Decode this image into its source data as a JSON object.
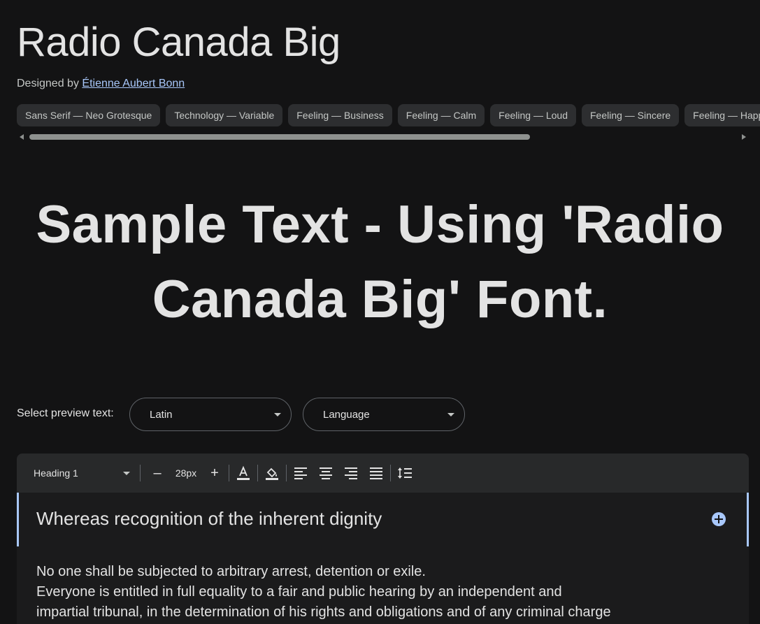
{
  "font": {
    "title": "Radio Canada Big",
    "designed_by_prefix": "Designed by",
    "designer_name": "Étienne Aubert Bonn"
  },
  "tags": [
    "Sans Serif — Neo Grotesque",
    "Technology — Variable",
    "Feeling — Business",
    "Feeling — Calm",
    "Feeling — Loud",
    "Feeling — Sincere",
    "Feeling — Happy"
  ],
  "sample": {
    "text": "Sample Text - Using 'Radio Canada Big' Font."
  },
  "preview": {
    "label": "Select preview text:",
    "script_value": "Latin",
    "language_value": "Language"
  },
  "toolbar": {
    "style_value": "Heading 1",
    "decrease_label": "–",
    "size_value": "28px",
    "increase_label": "+"
  },
  "editor": {
    "heading": "Whereas recognition of the inherent dignity",
    "body_lines": [
      "No one shall be subjected to arbitrary arrest, detention or exile.",
      "Everyone is entitled in full equality to a fair and public hearing by an independent and",
      "impartial tribunal, in the determination of his rights and obligations and of any criminal charge"
    ]
  },
  "colors": {
    "background": "#131314",
    "accent": "#a8c7fa",
    "chip_bg": "#2d2e30",
    "toolbar_bg": "#28292a"
  },
  "icons": {
    "text_color": "text-color-icon",
    "highlight": "fill-color-icon",
    "align_left": "align-left-icon",
    "align_center": "align-center-icon",
    "align_right": "align-right-icon",
    "align_justify": "align-justify-icon",
    "line_height": "line-spacing-icon",
    "add": "add-circle-icon"
  }
}
